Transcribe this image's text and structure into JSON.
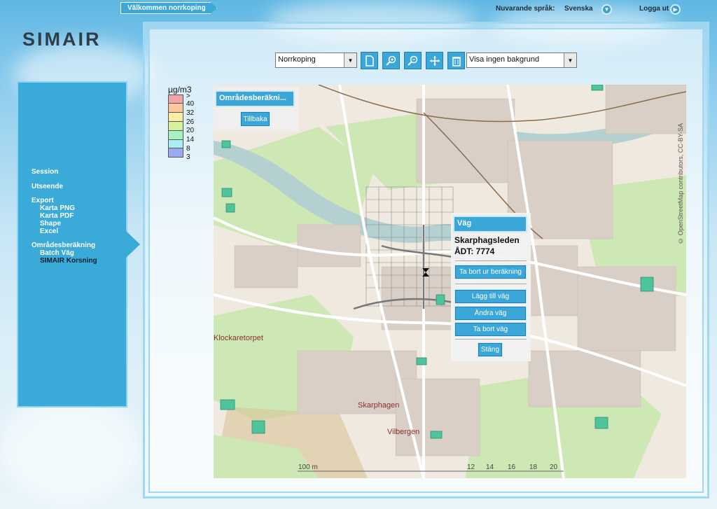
{
  "header": {
    "welcome": "Välkommen norrkoping",
    "language_label": "Nuvarande språk:",
    "language_value": "Svenska",
    "logout": "Logga ut"
  },
  "logo": "SIMAIR",
  "sidebar": {
    "items": [
      {
        "label": "Session"
      },
      {
        "label": "Utseende"
      },
      {
        "label": "Export"
      },
      {
        "label": "Karta PNG"
      },
      {
        "label": "Karta PDF"
      },
      {
        "label": "Shape"
      },
      {
        "label": "Excel"
      },
      {
        "label": "Områdesberäkning"
      },
      {
        "label": "Batch Väg"
      },
      {
        "label": "SIMAIR Korsning"
      }
    ]
  },
  "toolbar": {
    "city_select": "Norrkoping",
    "background_select": "Visa ingen bakgrund",
    "icons": [
      "new-document-icon",
      "zoom-in-icon",
      "zoom-out-icon",
      "pan-icon",
      "trash-icon"
    ]
  },
  "legend": {
    "unit": "µg/m3",
    "labels": [
      ">",
      "40",
      "32",
      "26",
      "20",
      "14",
      "8",
      "3"
    ],
    "colors": [
      "#f3a3a6",
      "#f9c89c",
      "#f8eda1",
      "#d6f19b",
      "#a7f1c1",
      "#a9eff1",
      "#9ea8ee"
    ]
  },
  "area_panel": {
    "title": "Områdesberäkni...",
    "back": "Tillbaka"
  },
  "road_popup": {
    "title": "Väg",
    "road_name": "Skarphagsleden",
    "adt": "ÅDT: 7774",
    "remove_calc": "Ta bort ur beräkning",
    "add_road": "Lägg till väg",
    "edit_road": "Ändra väg",
    "delete_road": "Ta bort väg",
    "close": "Stäng"
  },
  "map": {
    "places": [
      "Klockaretorpet",
      "Skarphagen",
      "Vilbergen"
    ],
    "scale": [
      "100 m",
      "12",
      "14",
      "16",
      "18",
      "20"
    ],
    "attribution": "© OpenStreetMap contributors, CC-BY-SA"
  },
  "colors": {
    "accent": "#3aa7d8",
    "frame": "#9ed8f2",
    "map_park": "#cde8b5",
    "map_water": "#b5d0d0",
    "map_building": "#d9cfc7"
  }
}
